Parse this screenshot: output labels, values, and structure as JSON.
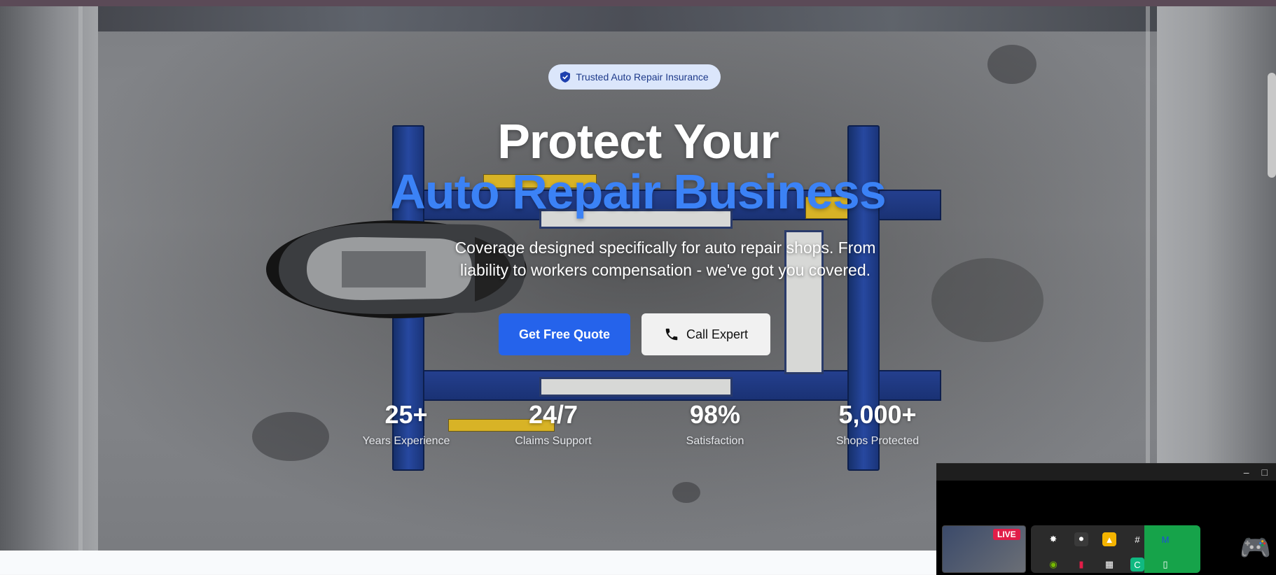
{
  "badge": {
    "icon": "shield-check-icon",
    "label": "Trusted Auto Repair Insurance"
  },
  "hero": {
    "title_line1": "Protect Your",
    "title_line2": "Auto Repair Business",
    "subtitle_line1": "Coverage designed specifically for auto repair shops. From",
    "subtitle_line2": "liability to workers compensation - we've got you covered.",
    "accent_color": "#3b82f6"
  },
  "buttons": {
    "quote_label": "Get Free Quote",
    "call_label": "Call Expert",
    "call_icon": "phone-icon"
  },
  "stats": [
    {
      "value": "25+",
      "label": "Years Experience"
    },
    {
      "value": "24/7",
      "label": "Claims Support"
    },
    {
      "value": "98%",
      "label": "Satisfaction"
    },
    {
      "value": "5,000+",
      "label": "Shops Protected"
    }
  ],
  "pip": {
    "minimize_icon": "minimize-icon",
    "maximize_icon": "maximize-icon",
    "live_label": "LIVE",
    "controller_icon": "gamepad-icon"
  },
  "colors": {
    "primary_button": "#2563eb",
    "secondary_button": "#f1f1f1",
    "badge_bg": "#dbe6fb"
  }
}
